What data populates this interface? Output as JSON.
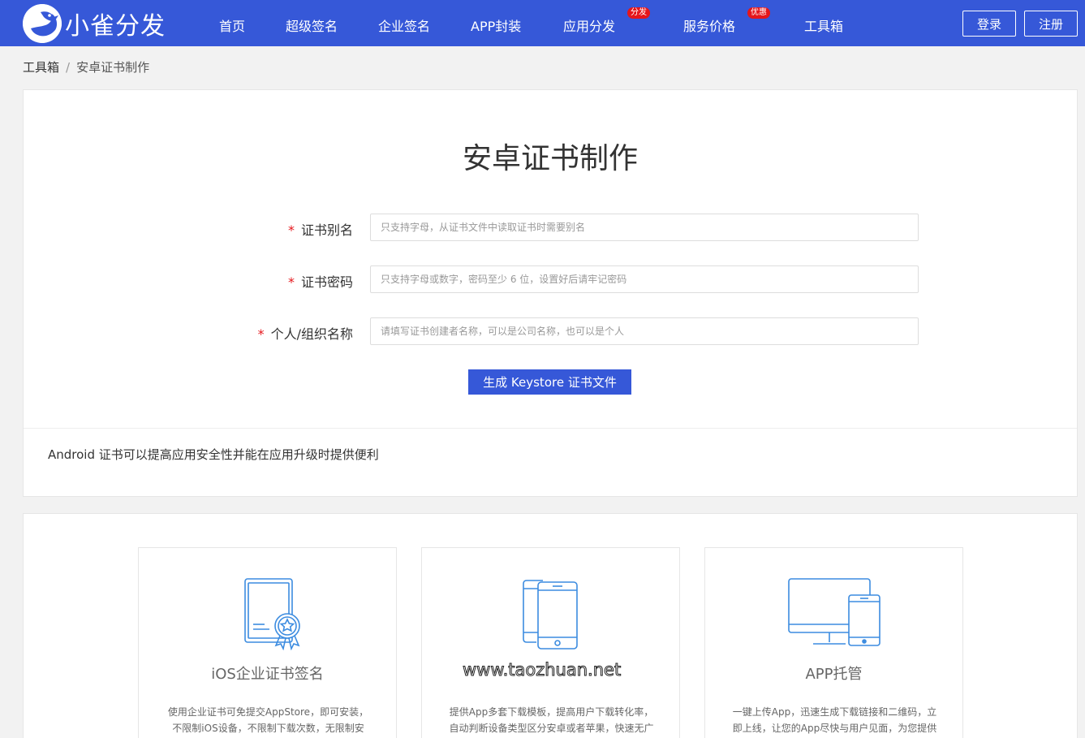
{
  "header": {
    "logo_text": "小雀分发",
    "nav": [
      {
        "label": "首页"
      },
      {
        "label": "超级签名"
      },
      {
        "label": "企业签名"
      },
      {
        "label": "APP封装"
      },
      {
        "label": "应用分发",
        "badge": "分发"
      },
      {
        "label": "服务价格",
        "badge": "优惠"
      },
      {
        "label": "工具箱"
      }
    ],
    "login_label": "登录",
    "register_label": "注册"
  },
  "breadcrumb": {
    "parent": "工具箱",
    "separator": "/",
    "current": "安卓证书制作"
  },
  "form": {
    "title": "安卓证书制作",
    "required_mark": "*",
    "fields": [
      {
        "label": "证书别名",
        "placeholder": "只支持字母，从证书文件中读取证书时需要别名",
        "value": ""
      },
      {
        "label": "证书密码",
        "placeholder": "只支持字母或数字，密码至少 6 位，设置好后请牢记密码",
        "value": ""
      },
      {
        "label": "个人/组织名称",
        "placeholder": "请填写证书创建者名称，可以是公司名称，也可以是个人",
        "value": ""
      }
    ],
    "submit_label": "生成 Keystore 证书文件",
    "description": "Android 证书可以提高应用安全性并能在应用升级时提供便利"
  },
  "features": [
    {
      "icon": "certificate-icon",
      "title": "iOS企业证书签名",
      "description": "使用企业证书可免提交AppStore，即可安装，不限制iOS设备，不限制下载次数，无限制安装。"
    },
    {
      "icon": "phones-icon",
      "title": "",
      "description": "提供App多套下载模板，提高用户下载转化率，自动判断设备类型区分安卓或者苹果，快速无广"
    },
    {
      "icon": "devices-icon",
      "title": "APP托管",
      "description": "一键上传App，迅速生成下载链接和二维码，立即上线，让您的App尽快与用户见面，为您提供"
    }
  ],
  "watermark": "www.taozhuan.net",
  "colors": {
    "brand": "#3658d8",
    "badge": "#e5161b",
    "icon_stroke": "#3c8ce0"
  }
}
